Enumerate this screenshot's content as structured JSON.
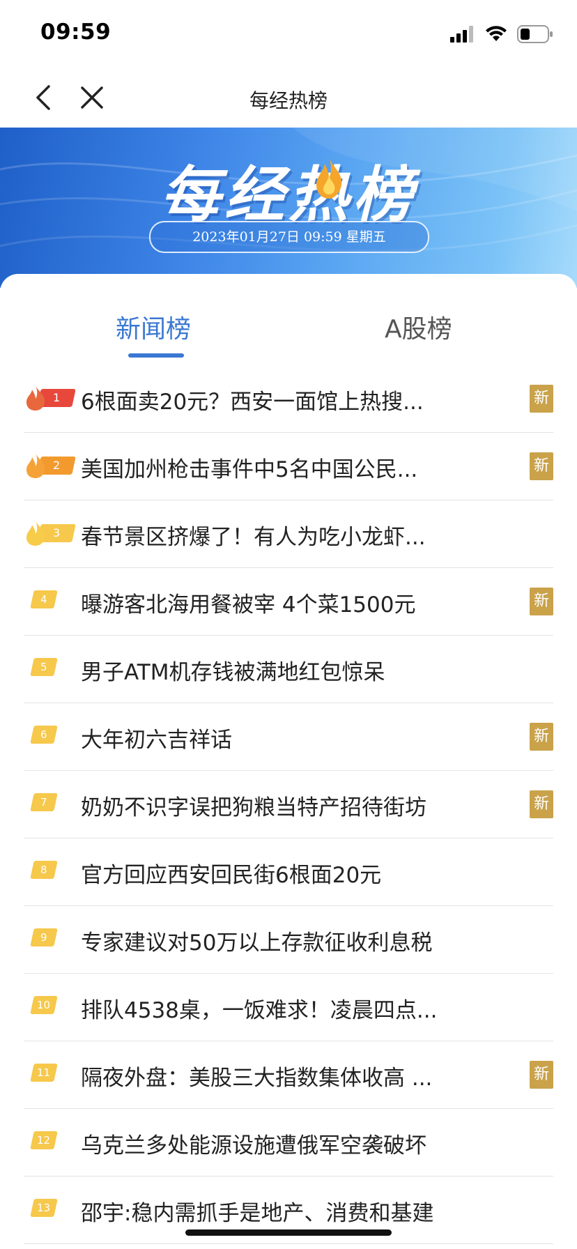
{
  "status_bar": {
    "time": "09:59"
  },
  "nav": {
    "title": "每经热榜"
  },
  "banner": {
    "title": "每经热榜",
    "datetime": "2023年01月27日 09:59 星期五"
  },
  "tabs": [
    {
      "label": "新闻榜",
      "active": true
    },
    {
      "label": "A股榜",
      "active": false
    }
  ],
  "new_badge_label": "新",
  "colors": {
    "accent": "#3a78d2",
    "new_badge": "#c9a24a",
    "rank_default": "#f6c84b",
    "rank1": "#e8473c",
    "rank2": "#f29a2e",
    "rank3": "#f6c84b"
  },
  "news": [
    {
      "rank": "1",
      "title": "6根面卖20元？西安一面馆上热搜...",
      "is_new": true
    },
    {
      "rank": "2",
      "title": "美国加州枪击事件中5名中国公民...",
      "is_new": true
    },
    {
      "rank": "3",
      "title": "春节景区挤爆了！有人为吃小龙虾...",
      "is_new": false
    },
    {
      "rank": "4",
      "title": "曝游客北海用餐被宰 4个菜1500元",
      "is_new": true
    },
    {
      "rank": "5",
      "title": "男子ATM机存钱被满地红包惊呆",
      "is_new": false
    },
    {
      "rank": "6",
      "title": "大年初六吉祥话",
      "is_new": true
    },
    {
      "rank": "7",
      "title": "奶奶不识字误把狗粮当特产招待街坊",
      "is_new": true
    },
    {
      "rank": "8",
      "title": "官方回应西安回民街6根面20元",
      "is_new": false
    },
    {
      "rank": "9",
      "title": "专家建议对50万以上存款征收利息税",
      "is_new": false
    },
    {
      "rank": "10",
      "title": "排队4538桌，一饭难求！凌晨四点...",
      "is_new": false
    },
    {
      "rank": "11",
      "title": "隔夜外盘：美股三大指数集体收高 ...",
      "is_new": true
    },
    {
      "rank": "12",
      "title": "乌克兰多处能源设施遭俄军空袭破坏",
      "is_new": false
    },
    {
      "rank": "13",
      "title": "邵宇:稳内需抓手是地产、消费和基建",
      "is_new": false
    }
  ]
}
